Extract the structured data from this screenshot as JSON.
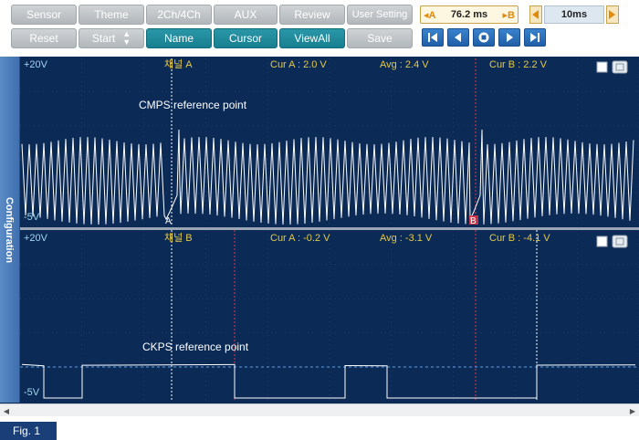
{
  "toolbar": {
    "row1": [
      {
        "key": "sensor",
        "label": "Sensor"
      },
      {
        "key": "theme",
        "label": "Theme"
      },
      {
        "key": "ch",
        "label": "2Ch/4Ch"
      },
      {
        "key": "aux",
        "label": "AUX"
      },
      {
        "key": "review",
        "label": "Review"
      },
      {
        "key": "user",
        "label": "User Setting"
      }
    ],
    "row2": [
      {
        "key": "reset",
        "label": "Reset"
      },
      {
        "key": "start",
        "label": "Start"
      },
      {
        "key": "name",
        "label": "Name"
      },
      {
        "key": "cursor",
        "label": "Cursor"
      },
      {
        "key": "viewall",
        "label": "ViewAll"
      },
      {
        "key": "save",
        "label": "Save"
      }
    ]
  },
  "cursor_readout": {
    "mark_a": "A",
    "mark_b": "B",
    "value": "76.2 ms"
  },
  "time_div": "10ms",
  "sidebar": {
    "label": "Configuration"
  },
  "channels": [
    {
      "scale_top": "+20V",
      "scale_bottom": "-5V",
      "name": "채널 A",
      "cur_a": "Cur A : 2.0 V",
      "avg": "Avg : 2.4 V",
      "cur_b": "Cur B : 2.2 V",
      "annotation": "CMPS reference point"
    },
    {
      "scale_top": "+20V",
      "scale_bottom": "-5V",
      "name": "채널 B",
      "cur_a": "Cur A : -0.2 V",
      "avg": "Avg : -3.1 V",
      "cur_b": "Cur B : -4.1 V",
      "annotation": "CKPS reference point"
    }
  ],
  "cursor_marks": {
    "a": "A",
    "b": "B"
  },
  "figure_label": "Fig. 1",
  "colors": {
    "scope_bg": "#0b2a56",
    "grid": "#6d8ab6",
    "trace": "#ffffff",
    "label_yellow": "#e3c94a",
    "label_cyan": "#9fd7ef",
    "cursor_red": "#e0364a",
    "teal_button": "#1d8a9c"
  }
}
